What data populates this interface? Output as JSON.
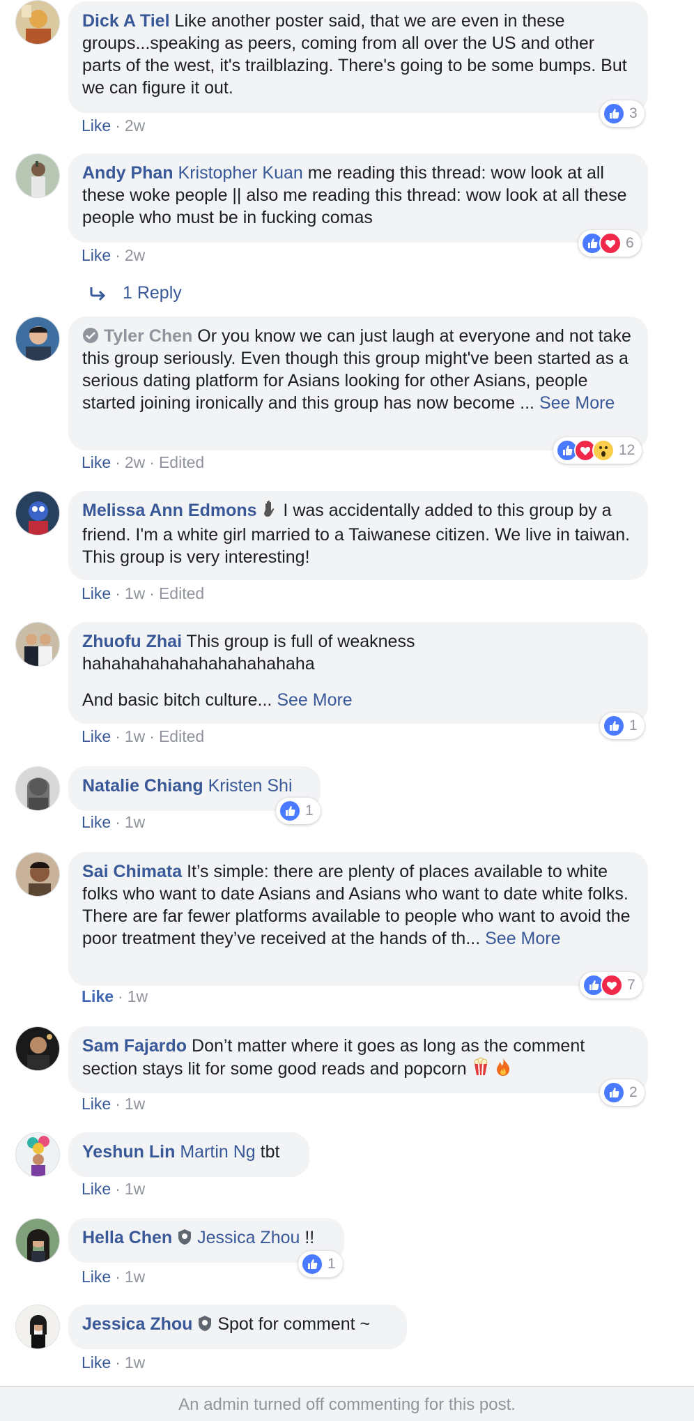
{
  "comments": [
    {
      "author": "Dick A Tiel",
      "mention": "",
      "text": "Like another poster said, that we are even in these groups...speaking as peers, coming from all over the US and other parts of the west, it's trailblazing. There's going to be some bumps. But we can figure it out.",
      "see_more": "",
      "like": "Like",
      "time": "2w",
      "edited": "",
      "reaction_count": "3"
    },
    {
      "author": "Andy Phan",
      "mention": "Kristopher Kuan",
      "text": "me reading this thread: wow look at all these woke people || also me reading this thread: wow look at all these people who must be in fucking comas",
      "see_more": "",
      "like": "Like",
      "time": "2w",
      "edited": "",
      "reaction_count": "6"
    },
    {
      "author": "Tyler Chen",
      "mention": "",
      "text": "Or you know we can just laugh at everyone and not take this group seriously. Even though this group might've been started as a serious dating platform for Asians looking for other Asians, people started joining ironically and this group has now become ...",
      "see_more": "See More",
      "like": "Like",
      "time": "2w",
      "edited": "Edited",
      "reaction_count": "12"
    },
    {
      "author": "Melissa Ann Edmons",
      "mention": "",
      "text": "I was accidentally added to this group by a friend. I'm a white girl married to a Taiwanese citizen. We live in taiwan. This group is very interesting!",
      "see_more": "",
      "like": "Like",
      "time": "1w",
      "edited": "Edited",
      "reaction_count": ""
    },
    {
      "author": "Zhuofu Zhai",
      "mention": "",
      "text": "This group is full of weakness hahahahahahahahahahahaha",
      "text2": "And basic bitch culture...",
      "see_more": "See More",
      "like": "Like",
      "time": "1w",
      "edited": "Edited",
      "reaction_count": "1"
    },
    {
      "author": "Natalie Chiang",
      "mention": "Kristen Shi",
      "text": "",
      "see_more": "",
      "like": "Like",
      "time": "1w",
      "edited": "",
      "reaction_count": "1"
    },
    {
      "author": "Sai Chimata",
      "mention": "",
      "text": "It’s simple: there are plenty of places available to white folks who want to date Asians and Asians who want to date white folks. There are far fewer platforms available to people who want to avoid the poor treatment they’ve received at the hands of th...",
      "see_more": "See More",
      "like": "Like",
      "time": "1w",
      "edited": "",
      "reaction_count": "7"
    },
    {
      "author": "Sam Fajardo",
      "mention": "",
      "text": "Don’t matter where it goes as long as the comment section stays lit for some good reads and popcorn",
      "see_more": "",
      "like": "Like",
      "time": "1w",
      "edited": "",
      "reaction_count": "2"
    },
    {
      "author": "Yeshun Lin",
      "mention": "Martin Ng",
      "text": "tbt",
      "see_more": "",
      "like": "Like",
      "time": "1w",
      "edited": "",
      "reaction_count": ""
    },
    {
      "author": "Hella Chen",
      "mention": "Jessica Zhou",
      "text": "!!",
      "see_more": "",
      "like": "Like",
      "time": "1w",
      "edited": "",
      "reaction_count": "1"
    },
    {
      "author": "Jessica Zhou",
      "mention": "",
      "text": "Spot for comment ~",
      "see_more": "",
      "like": "Like",
      "time": "1w",
      "edited": "",
      "reaction_count": ""
    }
  ],
  "reply_link": "1 Reply",
  "footer_text": "An admin turned off commenting for this post.",
  "colors": {
    "link": "#385898",
    "bubble": "#f2f3f5",
    "meta": "#90949c",
    "like_reaction": "#4a7aff",
    "love_reaction": "#f0284a",
    "wow_reaction": "#fbcd4d"
  },
  "icons": [
    "like-reaction-icon",
    "love-reaction-icon",
    "wow-reaction-icon",
    "reply-arrow-icon",
    "wave-emoji-icon",
    "popcorn-emoji-icon",
    "fire-emoji-icon",
    "admin-badge-icon",
    "moderator-shield-icon"
  ]
}
